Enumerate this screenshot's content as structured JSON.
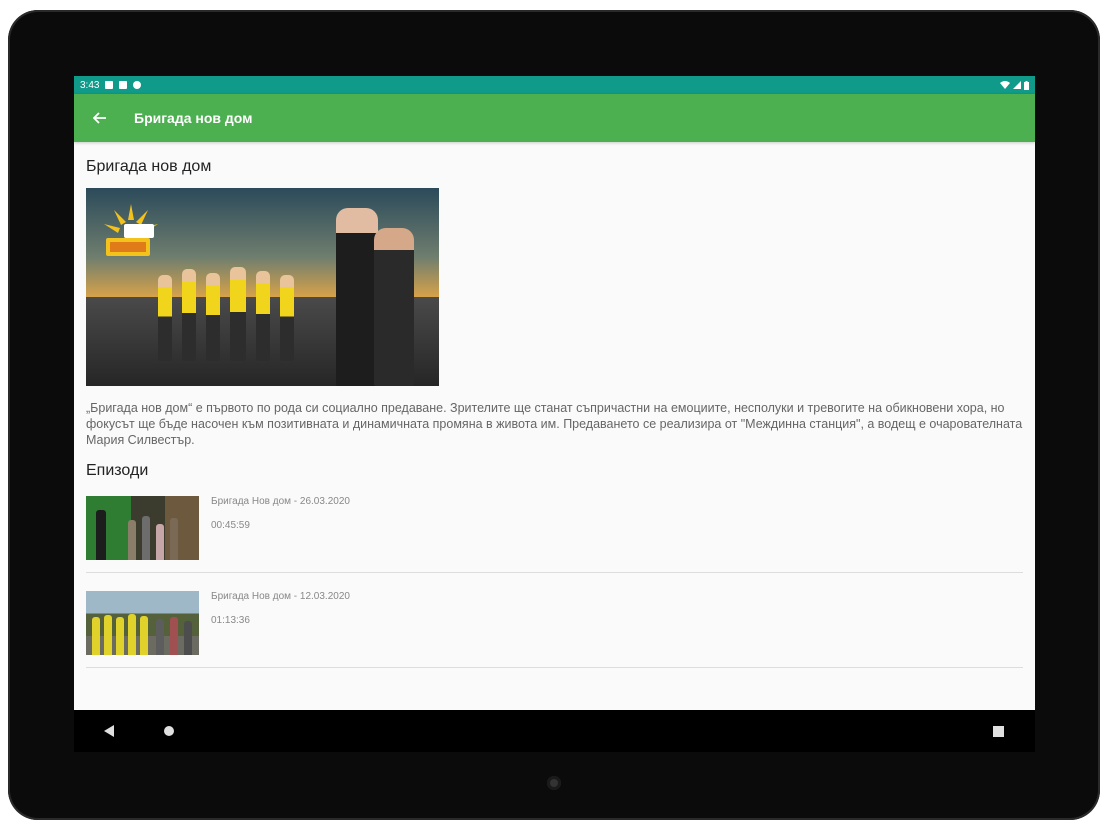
{
  "status_bar": {
    "time": "3:43"
  },
  "app_bar": {
    "title": "Бригада нов дом",
    "back_icon": "arrow-back-icon"
  },
  "show": {
    "title": "Бригада нов дом",
    "description": "„Бригада нов дом“ е първото по рода си социално предаване. Зрителите ще станат съпричастни на емоциите, несполуки и тревогите на обикновени хора, но фокусът ще бъде насочен към позитивната и динамичната промяна в живота им. Предаването се реализира от \"Междинна станция\", а водещ е очарователната Мария Силвестър."
  },
  "episodes_section": {
    "title": "Епизоди",
    "items": [
      {
        "title": "Бригада Нов дом - 26.03.2020",
        "duration": "00:45:59"
      },
      {
        "title": "Бригада Нов дом - 12.03.2020",
        "duration": "01:13:36"
      }
    ]
  },
  "colors": {
    "status_bar": "#0f9a8a",
    "app_bar": "#4caf50"
  }
}
